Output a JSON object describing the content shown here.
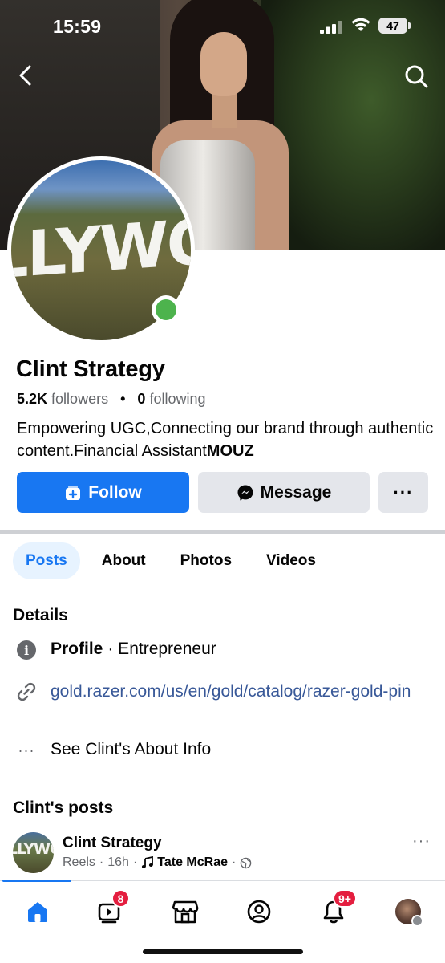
{
  "status_bar": {
    "time": "15:59",
    "battery": "47"
  },
  "profile": {
    "name": "Clint Strategy",
    "followers_count": "5.2K",
    "followers_label": "followers",
    "following_count": "0",
    "following_label": "following",
    "bio_text": "Empowering UGC,Connecting our brand through authentic content.Financial Assistant",
    "bio_bold": "MOUZ",
    "avatar_text": "LLYWO",
    "online": true
  },
  "actions": {
    "follow_label": "Follow",
    "message_label": "Message",
    "more_label": "···"
  },
  "tabs": [
    "Posts",
    "About",
    "Photos",
    "Videos"
  ],
  "details": {
    "title": "Details",
    "profile_label": "Profile",
    "profile_value": "· Entrepreneur",
    "link": "gold.razer.com/us/en/gold/catalog/razer-gold-pin",
    "see_about": "See Clint's About Info",
    "see_about_dots": "···"
  },
  "posts_section": {
    "title": "Clint's posts",
    "post": {
      "author": "Clint Strategy",
      "avatar_text": "LLYWO",
      "source": "Reels",
      "age": "16h",
      "music": "Tate McRae",
      "more": "···"
    }
  },
  "bottom_nav": {
    "items": [
      "home-icon",
      "video-icon",
      "marketplace-icon",
      "profile-icon",
      "bell-icon",
      "menu-avatar"
    ],
    "video_badge": "8",
    "notif_badge": "9+"
  },
  "colors": {
    "accent": "#1877f2",
    "badge": "#e41e3f",
    "online": "#4db34d"
  }
}
